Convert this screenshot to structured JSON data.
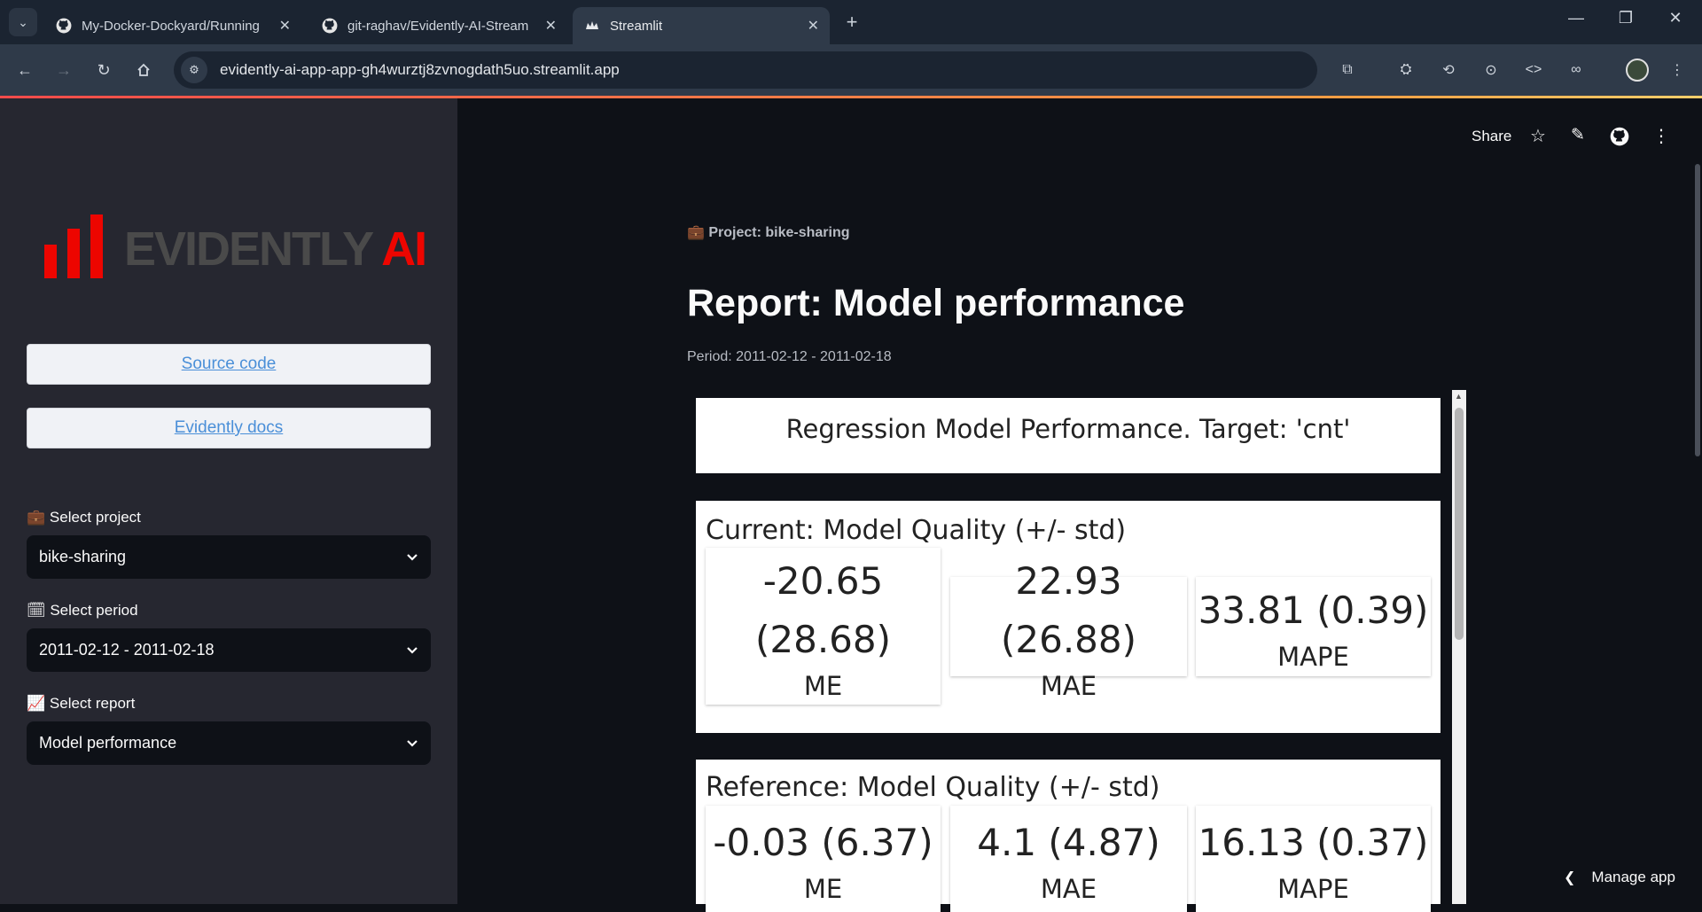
{
  "browser": {
    "tabs": [
      {
        "title": "My-Docker-Dockyard/Running"
      },
      {
        "title": "git-raghav/Evidently-AI-Streaml"
      },
      {
        "title": "Streamlit"
      }
    ],
    "url": "evidently-ai-app-app-gh4wurztj8zvnogdath5uo.streamlit.app"
  },
  "header": {
    "share_label": "Share"
  },
  "sidebar": {
    "logo_text_main": "EVIDENTLY",
    "logo_text_ai": "AI",
    "source_code_label": "Source code",
    "docs_label": "Evidently docs",
    "project": {
      "label": "Select project",
      "value": "bike-sharing"
    },
    "period": {
      "label": "Select period",
      "value": "2011-02-12 - 2011-02-18"
    },
    "report": {
      "label": "Select report",
      "value": "Model performance"
    }
  },
  "main": {
    "project_line": "Project: bike-sharing",
    "title": "Report: Model performance",
    "period_line": "Period: 2011-02-12 - 2011-02-18",
    "report_title": "Regression Model Performance. Target: 'cnt'",
    "current": {
      "title": "Current: Model Quality (+/- std)",
      "metrics": [
        {
          "value_line1": "-20.65",
          "value_line2": "(28.68)",
          "label": "ME"
        },
        {
          "value": "22.93 (26.88)",
          "label": "MAE"
        },
        {
          "value": "33.81 (0.39)",
          "label": "MAPE"
        }
      ]
    },
    "reference": {
      "title": "Reference: Model Quality (+/- std)",
      "metrics": [
        {
          "value": "-0.03 (6.37)",
          "label": "ME"
        },
        {
          "value": "4.1 (4.87)",
          "label": "MAE"
        },
        {
          "value": "16.13 (0.37)",
          "label": "MAPE"
        }
      ]
    }
  },
  "footer": {
    "manage_label": "Manage app"
  },
  "colors": {
    "accent": "#ff4b4b",
    "logo_red": "#ed0500",
    "sidebar_bg": "#262730",
    "main_bg": "#0e1117"
  }
}
